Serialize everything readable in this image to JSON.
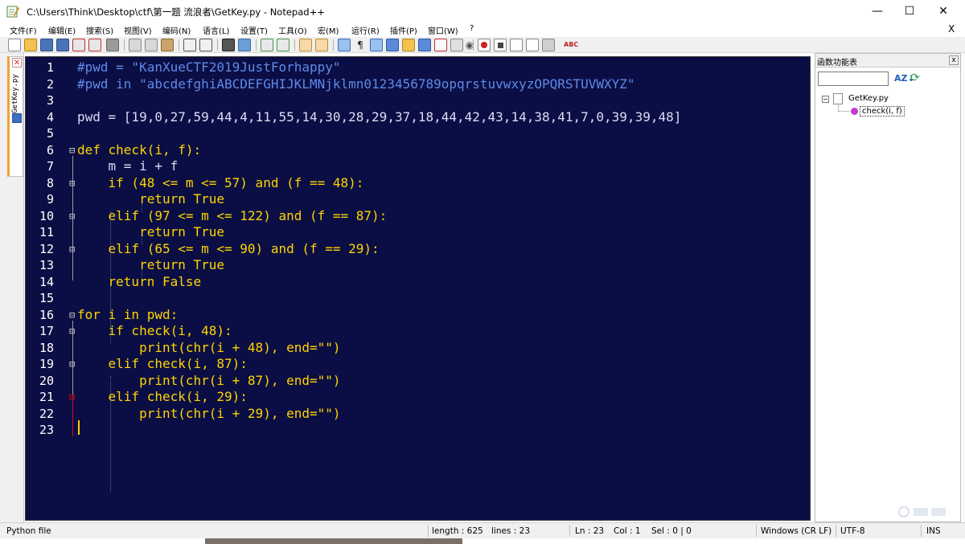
{
  "window": {
    "title": "C:\\Users\\Think\\Desktop\\ctf\\第一题 流浪者\\GetKey.py - Notepad++",
    "minimize_glyph": "—",
    "maximize_glyph": "☐",
    "close_glyph": "✕"
  },
  "menu": {
    "items": [
      "文件(F)",
      "编辑(E)",
      "搜索(S)",
      "视图(V)",
      "编码(N)",
      "语言(L)",
      "设置(T)",
      "工具(O)",
      "宏(M)",
      "运行(R)",
      "插件(P)",
      "窗口(W)",
      "?"
    ],
    "close_x": "X"
  },
  "tab": {
    "label": "GetKey.py",
    "close_glyph": "✕"
  },
  "editor": {
    "line_numbers": [
      "1",
      "2",
      "3",
      "4",
      "5",
      "6",
      "7",
      "8",
      "9",
      "10",
      "11",
      "12",
      "13",
      "14",
      "15",
      "16",
      "17",
      "18",
      "19",
      "20",
      "21",
      "22",
      "23"
    ],
    "lines": [
      "#pwd = \"KanXueCTF2019JustForhappy\"",
      "#pwd in \"abcdefghiABCDEFGHIJKLMNjklmn0123456789opqrstuvwxyzOPQRSTUVWXYZ\"",
      "",
      "pwd = [19,0,27,59,44,4,11,55,14,30,28,29,37,18,44,42,43,14,38,41,7,0,39,39,48]",
      "",
      "def check(i, f):",
      "    m = i + f",
      "    if (48 <= m <= 57) and (f == 48):",
      "        return True",
      "    elif (97 <= m <= 122) and (f == 87):",
      "        return True",
      "    elif (65 <= m <= 90) and (f == 29):",
      "        return True",
      "    return False",
      "",
      "for i in pwd:",
      "    if check(i, 48):",
      "        print(chr(i + 48), end=\"\")",
      "    elif check(i, 87):",
      "        print(chr(i + 87), end=\"\")",
      "    elif check(i, 29):",
      "        print(chr(i + 29), end=\"\")",
      ""
    ]
  },
  "function_list": {
    "title": "函数功能表",
    "close_glyph": "x",
    "search_value": "",
    "sort_glyph": "AZ↓",
    "reload_glyph": "⟳",
    "file_node": "GetKey.py",
    "function_node": "check(i, f)",
    "expander_glyph": "−"
  },
  "status": {
    "language": "Python file",
    "length": "length : 625",
    "lines": "lines : 23",
    "ln": "Ln : 23",
    "col": "Col : 1",
    "sel": "Sel : 0 | 0",
    "eol": "Windows (CR LF)",
    "encoding": "UTF-8",
    "mode": "INS"
  },
  "colors": {
    "editor_bg": "#0b0e44",
    "keyword": "#ffd400",
    "function_name": "#7fd8ff",
    "comment": "#5f8ae8",
    "text": "#dcdcf4",
    "line_number": "#ffffff"
  }
}
